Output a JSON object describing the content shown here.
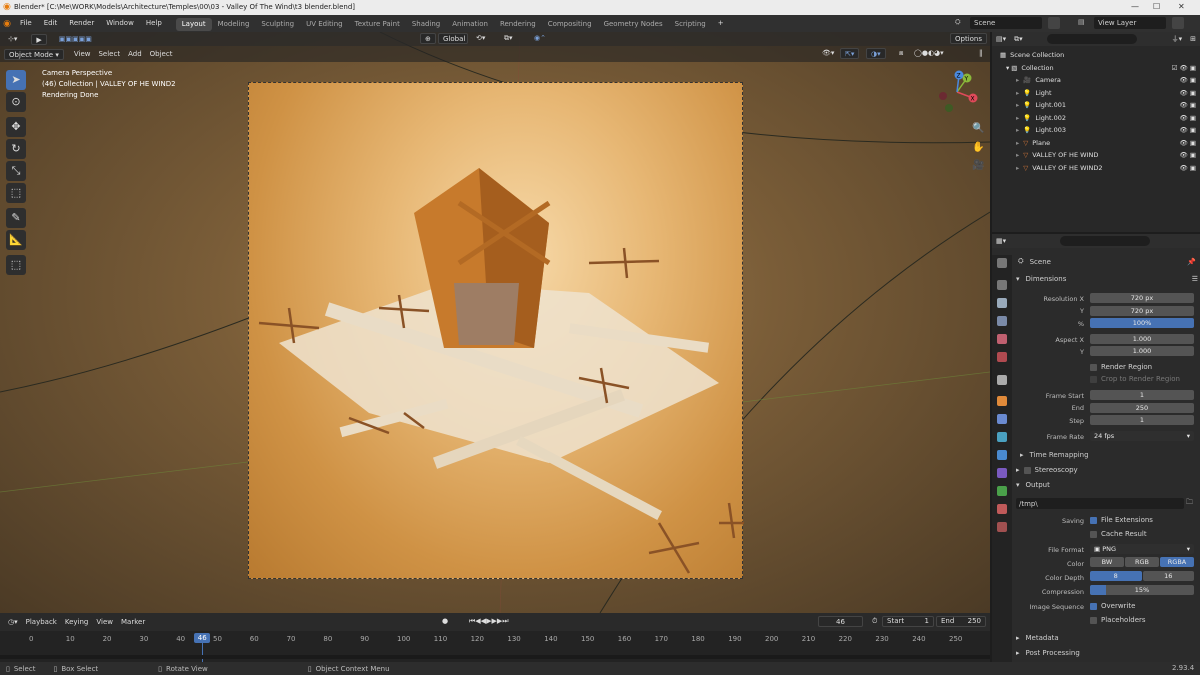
{
  "titlebar": {
    "title": "Blender* [C:\\Me\\WORK\\Models\\Architecture\\Temples\\00\\03 - Valley Of The Wind\\t3 blender.blend]"
  },
  "menubar": {
    "menus": [
      "File",
      "Edit",
      "Render",
      "Window",
      "Help"
    ],
    "workspaces": [
      "Layout",
      "Modeling",
      "Sculpting",
      "UV Editing",
      "Texture Paint",
      "Shading",
      "Animation",
      "Rendering",
      "Compositing",
      "Geometry Nodes",
      "Scripting"
    ],
    "active_workspace": "Layout",
    "scene": "Scene",
    "view_layer": "View Layer"
  },
  "viewport": {
    "mode": "Object Mode",
    "menus": [
      "View",
      "Select",
      "Add",
      "Object"
    ],
    "orientation": "Global",
    "options": "Options",
    "overlay": {
      "line1": "Camera Perspective",
      "line2": "(46) Collection | VALLEY OF HE WIND2",
      "line3": "Rendering Done"
    },
    "gizmo": {
      "x": "X",
      "y": "Y",
      "z": "Z"
    }
  },
  "timeline": {
    "menus": [
      "Playback",
      "Keying",
      "View",
      "Marker"
    ],
    "current_frame": "46",
    "start_label": "Start",
    "start": "1",
    "end_label": "End",
    "end": "250",
    "ticks": [
      "0",
      "10",
      "20",
      "30",
      "40",
      "50",
      "60",
      "70",
      "80",
      "90",
      "100",
      "110",
      "120",
      "130",
      "140",
      "150",
      "160",
      "170",
      "180",
      "190",
      "200",
      "210",
      "220",
      "230",
      "240",
      "250"
    ]
  },
  "statusbar": {
    "select": "Select",
    "box_select": "Box Select",
    "rotate": "Rotate View",
    "context": "Object Context Menu",
    "version": "2.93.4"
  },
  "outliner": {
    "root": "Scene Collection",
    "collection": "Collection",
    "items": [
      {
        "name": "Camera",
        "icon": "camera-icon"
      },
      {
        "name": "Light",
        "icon": "light-icon"
      },
      {
        "name": "Light.001",
        "icon": "light-icon"
      },
      {
        "name": "Light.002",
        "icon": "light-icon"
      },
      {
        "name": "Light.003",
        "icon": "light-icon"
      },
      {
        "name": "Plane",
        "icon": "mesh-icon"
      },
      {
        "name": "VALLEY OF HE WIND",
        "icon": "mesh-icon"
      },
      {
        "name": "VALLEY OF HE WIND2",
        "icon": "mesh-icon"
      }
    ]
  },
  "properties": {
    "context": "Scene",
    "dimensions": {
      "title": "Dimensions",
      "res_x_label": "Resolution X",
      "res_x": "720 px",
      "res_y_label": "Y",
      "res_y": "720 px",
      "pct_label": "%",
      "pct": "100%",
      "aspect_x_label": "Aspect X",
      "aspect_x": "1.000",
      "aspect_y_label": "Y",
      "aspect_y": "1.000",
      "render_region": "Render Region",
      "crop": "Crop to Render Region",
      "frame_start_label": "Frame Start",
      "frame_start": "1",
      "end_label": "End",
      "end": "250",
      "step_label": "Step",
      "step": "1",
      "rate_label": "Frame Rate",
      "rate": "24 fps"
    },
    "time_remapping": "Time Remapping",
    "stereoscopy": "Stereoscopy",
    "output": {
      "title": "Output",
      "path": "/tmp\\",
      "saving_label": "Saving",
      "file_ext": "File Extensions",
      "cache": "Cache Result",
      "format_label": "File Format",
      "format": "PNG",
      "color_label": "Color",
      "color_opts": [
        "BW",
        "RGB",
        "RGBA"
      ],
      "color_active": "RGBA",
      "depth_label": "Color Depth",
      "depth_opts": [
        "8",
        "16"
      ],
      "depth_active": "8",
      "compression_label": "Compression",
      "compression": "15%",
      "compression_value": 15,
      "seq_label": "Image Sequence",
      "overwrite": "Overwrite",
      "placeholders": "Placeholders"
    },
    "metadata": "Metadata",
    "post": "Post Processing"
  },
  "colors": {
    "accent": "#4672b4",
    "bg": "#1d1d1d"
  }
}
